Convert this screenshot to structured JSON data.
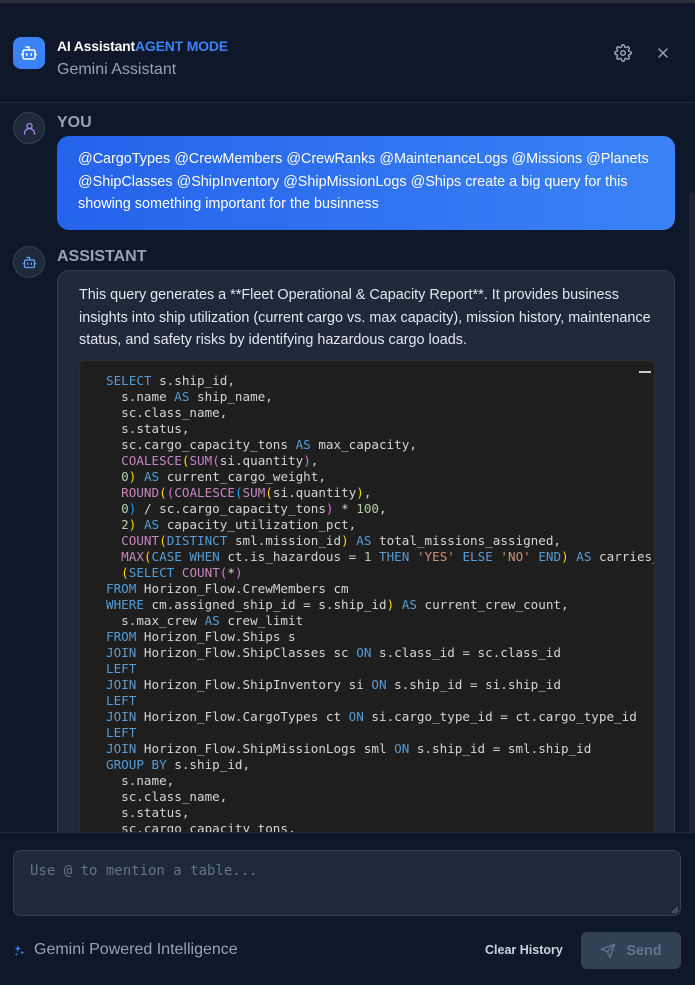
{
  "header": {
    "title": "AI Assistant",
    "mode": "AGENT MODE",
    "subtitle": "Gemini Assistant"
  },
  "icons": {
    "bot": "robot-icon",
    "settings": "gear-icon",
    "close": "close-icon",
    "user": "user-icon",
    "sparkle": "sparkle-icon",
    "send": "send-icon"
  },
  "colors": {
    "accent": "#3b82f6",
    "background": "#0f172a",
    "bubble": "#1e293b"
  },
  "messages": {
    "user": {
      "role": "YOU",
      "text": "@CargoTypes @CrewMembers @CrewRanks @MaintenanceLogs @Missions @Planets @ShipClasses @ShipInventory @ShipMissionLogs @Ships create a big query for this showing something important for the businness"
    },
    "assistant": {
      "role": "ASSISTANT",
      "text": "This query generates a **Fleet Operational & Capacity Report**. It provides business insights into ship utilization (current cargo vs. max capacity), mission history, maintenance status, and safety risks by identifying hazardous cargo loads."
    }
  },
  "footer": {
    "input_placeholder": "Use @ to mention a table...",
    "input_value": "",
    "powered_by": "Gemini Powered Intelligence",
    "clear_label": "Clear History",
    "send_label": "Send"
  }
}
